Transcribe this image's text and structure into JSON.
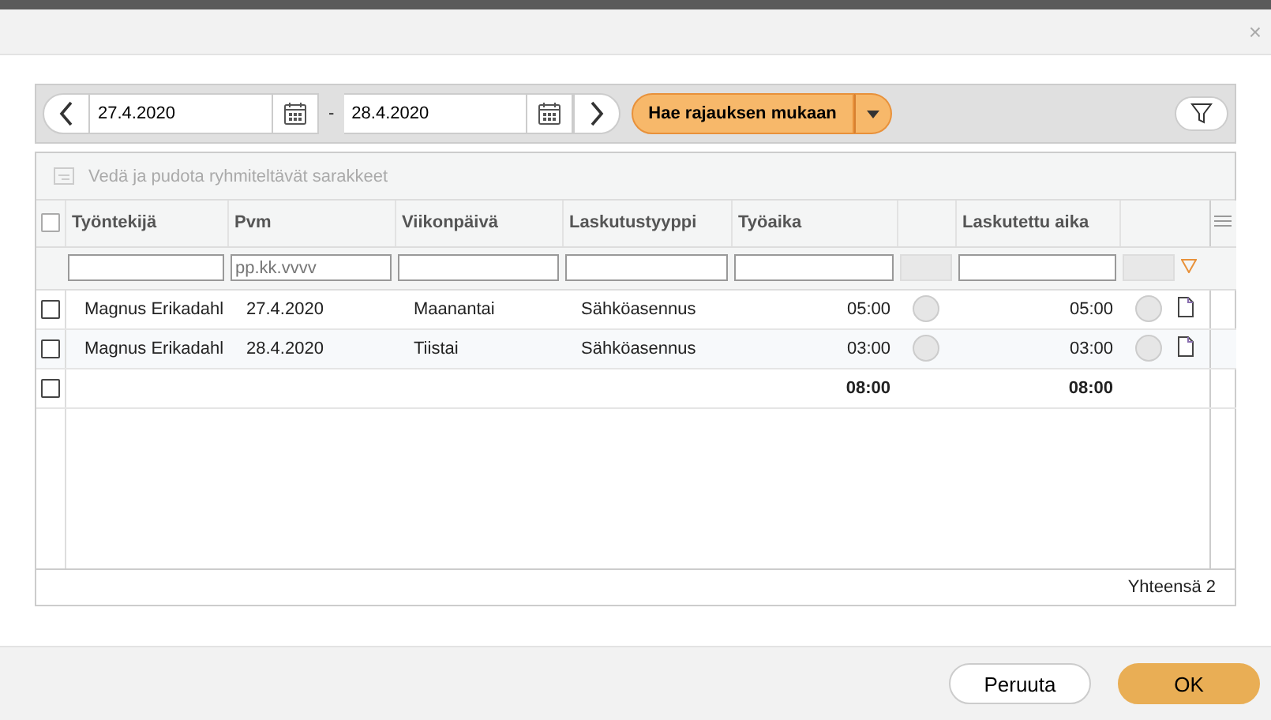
{
  "dialog": {
    "close": "×"
  },
  "toolbar": {
    "start_date": "27.4.2020",
    "separator": "-",
    "end_date": "28.4.2020",
    "search_button": "Hae rajauksen mukaan"
  },
  "group_bar": {
    "hint": "Vedä ja pudota ryhmiteltävät sarakkeet"
  },
  "table": {
    "header_checked": false,
    "columns": [
      {
        "kind": "text",
        "label": "Työntekijä"
      },
      {
        "kind": "text",
        "label": "Pvm",
        "placeholder": "pp.kk.vvvv"
      },
      {
        "kind": "text",
        "label": "Viikonpäivä"
      },
      {
        "kind": "text",
        "label": "Laskutustyyppi"
      },
      {
        "kind": "time",
        "label": "Työaika"
      },
      {
        "kind": "status"
      },
      {
        "kind": "time",
        "label": "Laskutettu aika"
      },
      {
        "kind": "status"
      }
    ],
    "rows": [
      {
        "checked": false,
        "cells": [
          "Magnus Erikadahl",
          "27.4.2020",
          "Maanantai",
          "Sähköasennus",
          "05:00",
          "",
          "05:00",
          ""
        ]
      },
      {
        "checked": false,
        "cells": [
          "Magnus Erikadahl",
          "28.4.2020",
          "Tiistai",
          "Sähköasennus",
          "03:00",
          "",
          "03:00",
          ""
        ]
      }
    ],
    "totals": {
      "checked": false,
      "work_time": "08:00",
      "billed_time": "08:00"
    },
    "footer": "Yhteensä 2"
  },
  "buttons": {
    "cancel": "Peruuta",
    "ok": "OK"
  }
}
